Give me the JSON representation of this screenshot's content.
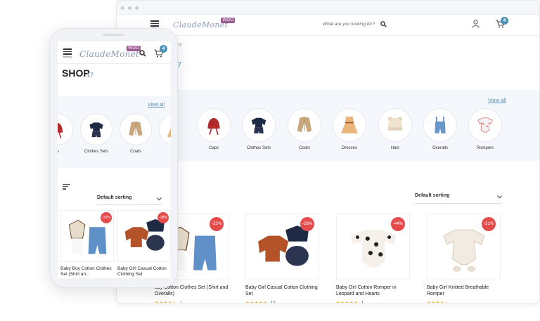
{
  "brand": {
    "logo_text": "ClaudeMonet",
    "woo_badge": "WOO",
    "accent": "#4a90b8",
    "sale_color": "#e54b4b"
  },
  "desktop": {
    "menu_label": "MENU",
    "search_placeholder": "What are you looking for?",
    "cart_count": "4",
    "breadcrumb_fragment": "op",
    "shop_count_fragment": "7",
    "view_all": "View all",
    "categories": [
      {
        "label": "s"
      },
      {
        "label": "Caps"
      },
      {
        "label": "Clothes Sets"
      },
      {
        "label": "Coats"
      },
      {
        "label": "Dresses"
      },
      {
        "label": "Hats"
      },
      {
        "label": "Overalls"
      },
      {
        "label": "Rompers"
      }
    ],
    "sorting": "Default sorting",
    "products": [
      {
        "name": "aby Cotton Clothes Set (Shirt and Overalls)",
        "sale": "-32%",
        "rating": 4,
        "count": "1"
      },
      {
        "name": "Baby Girl Casual Cotton Clothing Set",
        "sale": "-28%",
        "rating": 5,
        "count": "12"
      },
      {
        "name": "Baby Girl Cotton Romper in Leopard and Hearts",
        "sale": "-44%",
        "rating": 5,
        "count": "1"
      },
      {
        "name": "Baby Girl Knitted Breathable Romper",
        "sale": "-31%",
        "rating": 4,
        "count": ""
      }
    ]
  },
  "mobile": {
    "menu_label": "MENU",
    "cart_count": "4",
    "shop_title": "SHOP",
    "shop_count": "17",
    "view_all": "View all",
    "categories": [
      {
        "label": "ps"
      },
      {
        "label": "Clothes Sets"
      },
      {
        "label": "Coats"
      },
      {
        "label": "Dre"
      }
    ],
    "sorting": "Default sorting",
    "products": [
      {
        "name": "Baby Boy Cotton Clothes Set (Shirt an...",
        "sale": "-32%"
      },
      {
        "name": "Baby Girl Casual Cotton Clothing Set",
        "sale": "-28%"
      }
    ]
  }
}
